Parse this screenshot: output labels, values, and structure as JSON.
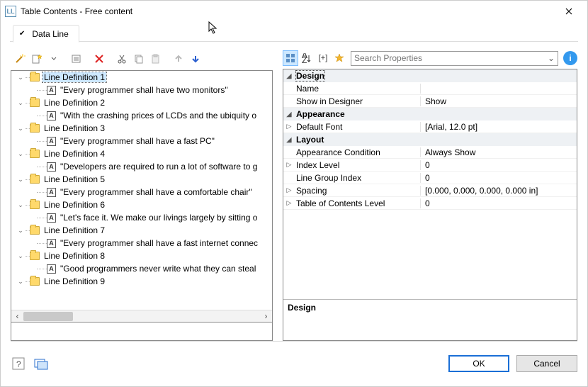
{
  "window": {
    "title": "Table Contents - Free content"
  },
  "tabs": [
    {
      "label": "Data Line",
      "checked": true
    }
  ],
  "tree": {
    "items": [
      {
        "kind": "folder",
        "label": "Line Definition  1",
        "selected": true
      },
      {
        "kind": "text",
        "label": "\"Every programmer shall have two monitors\""
      },
      {
        "kind": "folder",
        "label": "Line Definition  2"
      },
      {
        "kind": "text",
        "label": "\"With the crashing prices of LCDs and the ubiquity o"
      },
      {
        "kind": "folder",
        "label": "Line Definition  3"
      },
      {
        "kind": "text",
        "label": "\"Every programmer shall have a fast PC\""
      },
      {
        "kind": "folder",
        "label": "Line Definition  4"
      },
      {
        "kind": "text",
        "label": "\"Developers are required to run a lot of software to g"
      },
      {
        "kind": "folder",
        "label": "Line Definition  5"
      },
      {
        "kind": "text",
        "label": "\"Every programmer shall have a comfortable chair\""
      },
      {
        "kind": "folder",
        "label": "Line Definition  6"
      },
      {
        "kind": "text",
        "label": "\"Let's face it. We make our livings largely by sitting o"
      },
      {
        "kind": "folder",
        "label": "Line Definition  7"
      },
      {
        "kind": "text",
        "label": "\"Every programmer shall have a fast internet connec"
      },
      {
        "kind": "folder",
        "label": "Line Definition  8"
      },
      {
        "kind": "text",
        "label": "\"Good programmers never write what they can steal"
      },
      {
        "kind": "folder",
        "label": "Line Definition  9"
      }
    ]
  },
  "search": {
    "placeholder": "Search Properties"
  },
  "propgrid": {
    "groups": [
      {
        "name": "Design",
        "selected": true,
        "rows": [
          {
            "name": "Name",
            "value": ""
          },
          {
            "name": "Show in Designer",
            "value": "Show"
          }
        ]
      },
      {
        "name": "Appearance",
        "rows": [
          {
            "name": "Default Font",
            "value": "[Arial, 12.0 pt]",
            "expandable": true
          }
        ]
      },
      {
        "name": "Layout",
        "rows": [
          {
            "name": "Appearance Condition",
            "value": "Always Show"
          },
          {
            "name": "Index Level",
            "value": "0",
            "expandable": true
          },
          {
            "name": "Line Group Index",
            "value": "0"
          },
          {
            "name": "Spacing",
            "value": "[0.000, 0.000, 0.000, 0.000 in]",
            "expandable": true
          },
          {
            "name": "Table of Contents Level",
            "value": "0",
            "expandable": true
          }
        ]
      }
    ],
    "description_title": "Design"
  },
  "buttons": {
    "ok": "OK",
    "cancel": "Cancel"
  }
}
